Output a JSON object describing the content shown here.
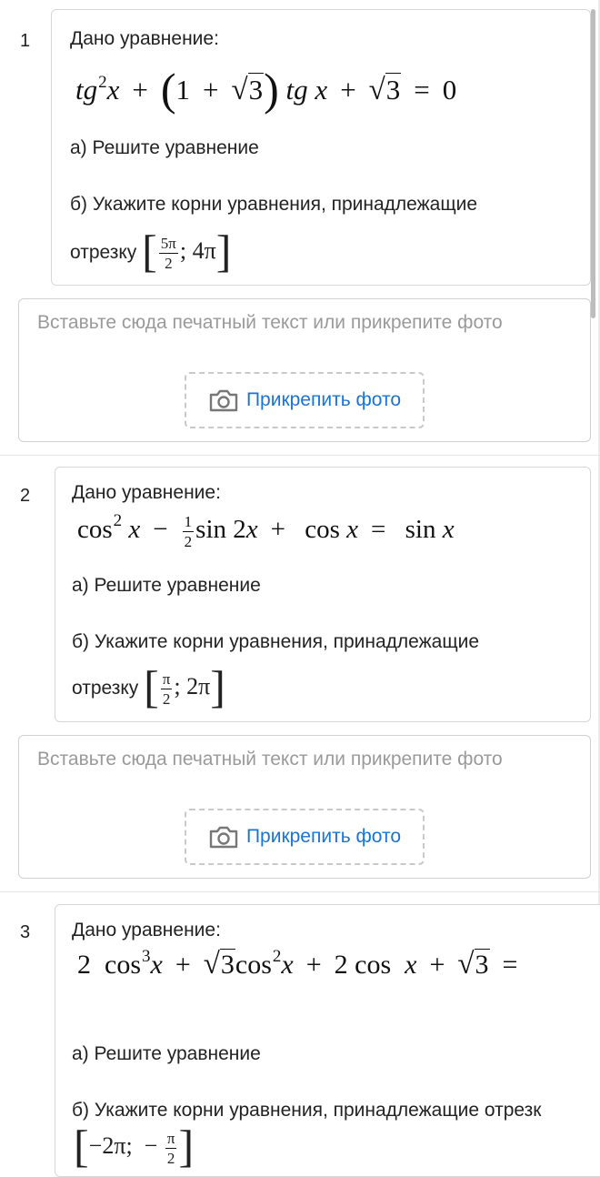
{
  "tasks": [
    {
      "number": "1",
      "given": "Дано уравнение:",
      "part_a": "а) Решите уравнение",
      "part_b": "б) Укажите корни уравнения, принадлежащие",
      "segment_word": "отрезку"
    },
    {
      "number": "2",
      "given": "Дано уравнение:",
      "part_a": "а) Решите уравнение",
      "part_b": "б) Укажите корни уравнения, принадлежащие",
      "segment_word": "отрезку"
    },
    {
      "number": "3",
      "given": "Дано уравнение:",
      "part_a": "а) Решите уравнение",
      "part_b": "б) Укажите корни уравнения, принадлежащие отрезк"
    }
  ],
  "answer": {
    "placeholder": "Вставьте сюда печатный текст или прикрепите фото",
    "attach_label": "Прикрепить фото",
    "attach_icon": "camera-icon",
    "accent": "#1a73d6"
  }
}
